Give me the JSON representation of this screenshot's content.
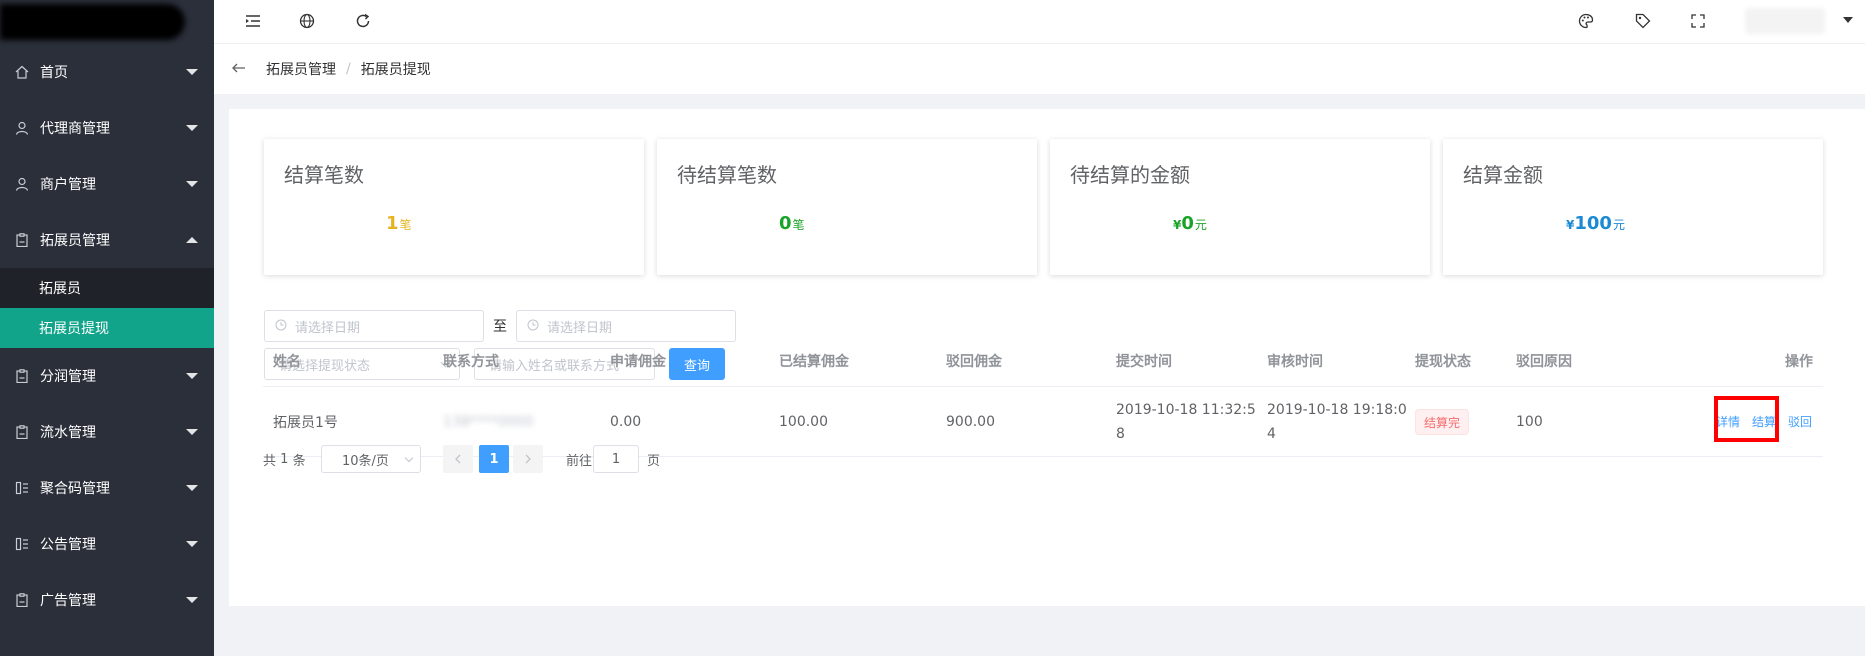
{
  "sidebar": {
    "items": [
      {
        "label": "首页",
        "icon": "home-icon",
        "expanded": false
      },
      {
        "label": "代理商管理",
        "icon": "user-icon",
        "expanded": false
      },
      {
        "label": "商户管理",
        "icon": "user-icon",
        "expanded": false
      },
      {
        "label": "拓展员管理",
        "icon": "clipboard-icon",
        "expanded": true,
        "children": [
          {
            "label": "拓展员",
            "active": false
          },
          {
            "label": "拓展员提现",
            "active": true
          }
        ]
      },
      {
        "label": "分润管理",
        "icon": "clipboard-icon",
        "expanded": false
      },
      {
        "label": "流水管理",
        "icon": "clipboard-icon",
        "expanded": false
      },
      {
        "label": "聚合码管理",
        "icon": "grid-icon",
        "expanded": false
      },
      {
        "label": "公告管理",
        "icon": "grid-icon",
        "expanded": false
      },
      {
        "label": "广告管理",
        "icon": "clipboard-icon",
        "expanded": false
      }
    ]
  },
  "topbar": {
    "icons": [
      "menu-fold-icon",
      "globe-icon",
      "refresh-icon",
      "palette-icon",
      "tag-icon",
      "fullscreen-icon"
    ]
  },
  "breadcrumb": {
    "parent": "拓展员管理",
    "separator": "/",
    "current": "拓展员提现"
  },
  "stats": [
    {
      "title": "结算笔数",
      "prefix": "",
      "value": "1",
      "unit": "笔",
      "color": "#e6b422"
    },
    {
      "title": "待结算笔数",
      "prefix": "",
      "value": "0",
      "unit": "笔",
      "color": "#1aa329"
    },
    {
      "title": "待结算的金额",
      "prefix": "¥",
      "value": "0",
      "unit": "元",
      "color": "#1aa329"
    },
    {
      "title": "结算金额",
      "prefix": "¥",
      "value": "100",
      "unit": "元",
      "color": "#1b8ad3"
    }
  ],
  "filters": {
    "date_start_placeholder": "请选择日期",
    "range_separator": "至",
    "date_end_placeholder": "请选择日期",
    "status_placeholder": "请选择提现状态",
    "keyword_placeholder": "请输入姓名或联系方式",
    "search_label": "查询"
  },
  "table": {
    "columns": [
      "姓名",
      "联系方式",
      "申请佣金",
      "已结算佣金",
      "驳回佣金",
      "提交时间",
      "审核时间",
      "提现状态",
      "驳回原因",
      "操作"
    ],
    "rows": [
      {
        "name": "拓展员1号",
        "contact": "138****0000",
        "applied": "0.00",
        "settled": "100.00",
        "rejected": "900.00",
        "submit_time_l1": "2019-10-18 11:32:5",
        "submit_time_l2": "8",
        "review_time_l1": "2019-10-18 19:18:0",
        "review_time_l2": "4",
        "status": "结算完",
        "reason": "100",
        "actions": {
          "detail": "详情",
          "settle": "结算",
          "reject": "驳回"
        }
      }
    ]
  },
  "pagination": {
    "total_prefix": "共",
    "total": "1",
    "total_suffix": "条",
    "page_size": "10条/页",
    "current_page": "1",
    "goto_prefix": "前往",
    "goto_value": "1",
    "goto_suffix": "页"
  }
}
